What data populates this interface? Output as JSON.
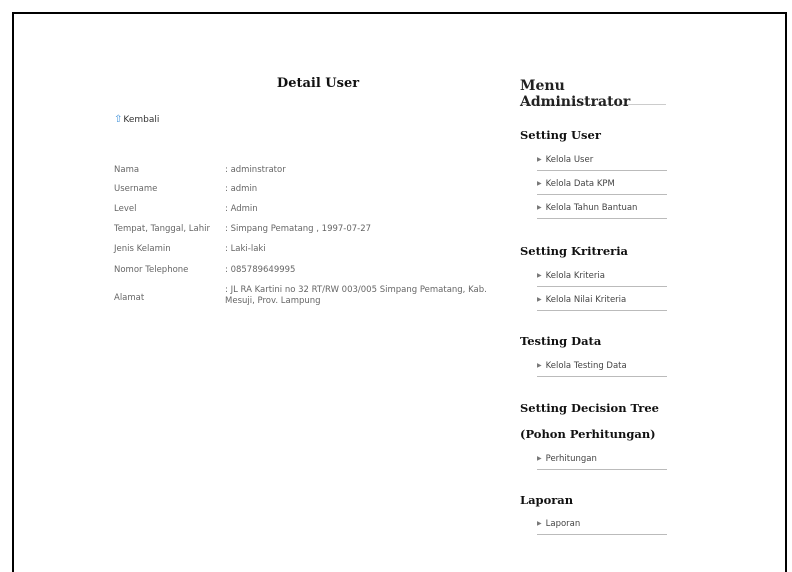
{
  "detail": {
    "title": "Detail User",
    "back_label": "Kembali",
    "fields": [
      {
        "label": "Nama",
        "value": ": adminstrator"
      },
      {
        "label": "Username",
        "value": ": admin"
      },
      {
        "label": "Level",
        "value": ": Admin"
      },
      {
        "label": "Tempat, Tanggal, Lahir",
        "value": ": Simpang Pematang , 1997-07-27"
      },
      {
        "label": "Jenis Kelamin",
        "value": ": Laki-laki"
      },
      {
        "label": "Nomor Telephone",
        "value": ": 085789649995"
      },
      {
        "label": "Alamat",
        "value": ": JL RA Kartini no 32 RT/RW 003/005 Simpang Pematang, Kab. Mesuji, Prov. Lampung"
      }
    ]
  },
  "sidebar": {
    "title": "Menu Administrator",
    "sections": [
      {
        "heading": "Setting User",
        "items": [
          "Kelola User",
          "Kelola Data KPM",
          "Kelola Tahun Bantuan"
        ]
      },
      {
        "heading": "Setting Kritreria",
        "items": [
          "Kelola Kriteria",
          "Kelola Nilai Kriteria"
        ]
      },
      {
        "heading": "Testing Data",
        "items": [
          "Kelola Testing Data"
        ]
      },
      {
        "heading": "Setting Decision Tree",
        "heading2": "(Pohon Perhitungan)",
        "items": [
          "Perhitungan"
        ]
      },
      {
        "heading": "Laporan",
        "items": [
          "Laporan"
        ]
      }
    ]
  },
  "icons": {
    "back": "arrow-up-icon",
    "bullet": "triangle-right-icon"
  },
  "colors": {
    "back_icon": "#3a8fd8"
  }
}
